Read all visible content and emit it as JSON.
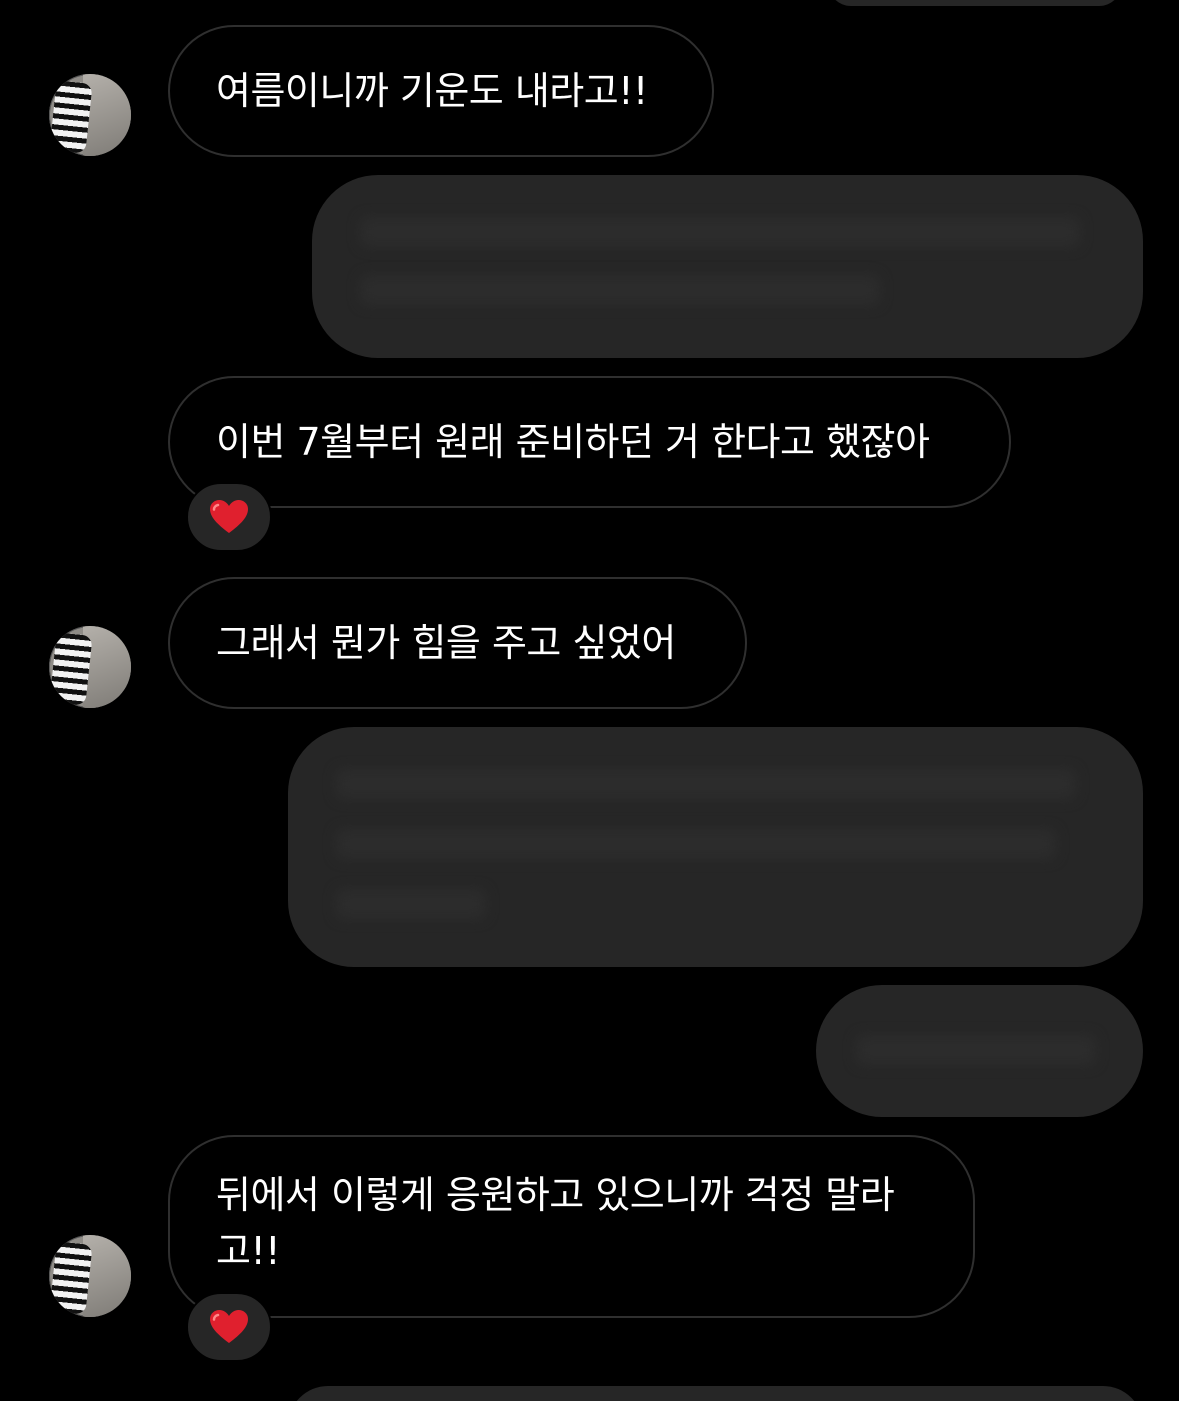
{
  "conversation": {
    "messages": [
      {
        "from": "them",
        "text": "여름이니까 기운도 내라고!!"
      },
      {
        "from": "me",
        "text": ""
      },
      {
        "from": "them",
        "text": "이번 7월부터 원래 준비하던 거 한다고 했잖아",
        "reaction": "heart-emoji"
      },
      {
        "from": "them",
        "text": "그래서 뭔가 힘을 주고 싶었어"
      },
      {
        "from": "me",
        "text": ""
      },
      {
        "from": "me",
        "text": ""
      },
      {
        "from": "them",
        "text": "뒤에서 이렇게 응원하고 있으니까 걱정 말라\n고!!",
        "reaction": "heart-emoji"
      }
    ]
  },
  "colors": {
    "background": "#000000",
    "incoming_border": "#2f2f2f",
    "outgoing_bubble": "#262626",
    "text": "#ffffff",
    "heart": "#e0202e"
  }
}
